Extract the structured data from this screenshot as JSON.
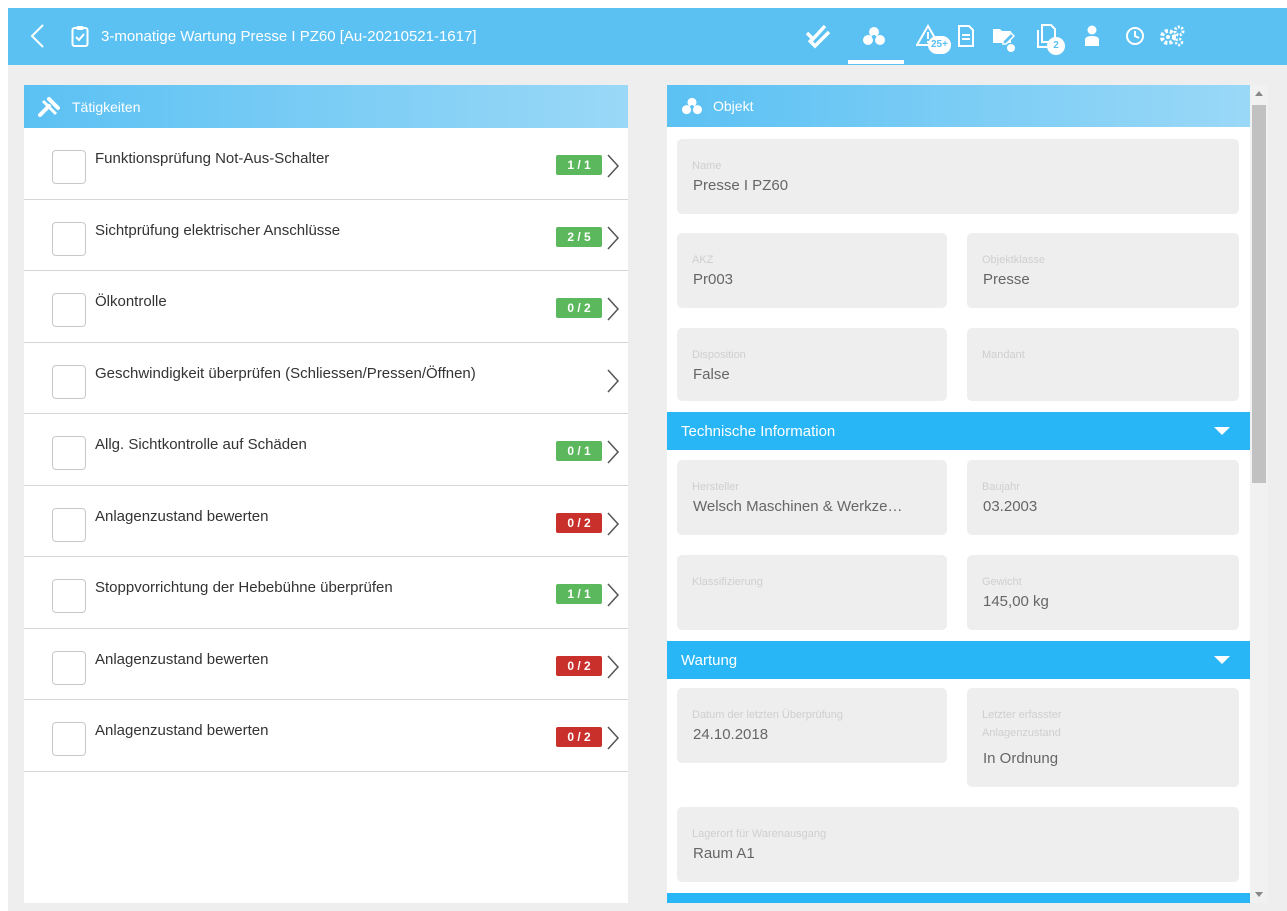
{
  "colors": {
    "primary": "#5bc1f3",
    "section": "#29b6f6",
    "badge_green": "#5cb85c",
    "badge_red": "#c9302c"
  },
  "header": {
    "title": "3-monatige Wartung Presse I PZ60 [Au-20210521-1617]",
    "toolbar": [
      {
        "icon": "double-check-icon"
      },
      {
        "icon": "object-icon",
        "active": true
      },
      {
        "icon": "warning-icon",
        "badge": "25+"
      },
      {
        "icon": "document-icon"
      },
      {
        "icon": "folder-edit-icon",
        "dot": true
      },
      {
        "icon": "copy-documents-icon",
        "badge": "2"
      },
      {
        "icon": "person-icon"
      },
      {
        "icon": "clock-icon"
      },
      {
        "icon": "settings-icon"
      }
    ]
  },
  "tasks_panel": {
    "title": "Tätigkeiten",
    "items": [
      {
        "label": "Funktionsprüfung Not-Aus-Schalter",
        "badge": "1 / 1",
        "status": "green"
      },
      {
        "label": "Sichtprüfung elektrischer Anschlüsse",
        "badge": "2 / 5",
        "status": "green"
      },
      {
        "label": "Ölkontrolle",
        "badge": "0 / 2",
        "status": "green"
      },
      {
        "label": "Geschwindigkeit überprüfen (Schliessen/Pressen/Öffnen)",
        "badge": "",
        "status": "none"
      },
      {
        "label": "Allg. Sichtkontrolle auf Schäden",
        "badge": "0 / 1",
        "status": "green"
      },
      {
        "label": "Anlagenzustand bewerten",
        "badge": "0 / 2",
        "status": "red"
      },
      {
        "label": "Stoppvorrichtung der Hebebühne überprüfen",
        "badge": "1 / 1",
        "status": "green"
      },
      {
        "label": "Anlagenzustand bewerten",
        "badge": "0 / 2",
        "status": "red"
      },
      {
        "label": "Anlagenzustand bewerten",
        "badge": "0 / 2",
        "status": "red"
      }
    ]
  },
  "object_panel": {
    "title": "Objekt",
    "name": {
      "label": "Name",
      "value": "Presse I PZ60"
    },
    "akz": {
      "label": "AKZ",
      "value": "Pr003"
    },
    "objektklasse": {
      "label": "Objektklasse",
      "value": "Presse"
    },
    "disposition": {
      "label": "Disposition",
      "value": "False"
    },
    "mandant": {
      "label": "Mandant",
      "value": ""
    },
    "tech_section": "Technische Information",
    "hersteller": {
      "label": "Hersteller",
      "value": "Welsch Maschinen & Werkze…"
    },
    "baujahr": {
      "label": "Baujahr",
      "value": "03.2003"
    },
    "klassifizierung": {
      "label": "Klassifizierung",
      "value": ""
    },
    "gewicht": {
      "label": "Gewicht",
      "value": "145,00 kg"
    },
    "wartung_section": "Wartung",
    "letzte_pruefung": {
      "label": "Datum der letzten Überprüfung",
      "value": "24.10.2018"
    },
    "letzter_zustand": {
      "label": "Letzter erfasster Anlagenzustand",
      "value": "In Ordnung"
    },
    "lagerort": {
      "label": "Lagerort für Warenausgang",
      "value": "Raum A1"
    }
  }
}
